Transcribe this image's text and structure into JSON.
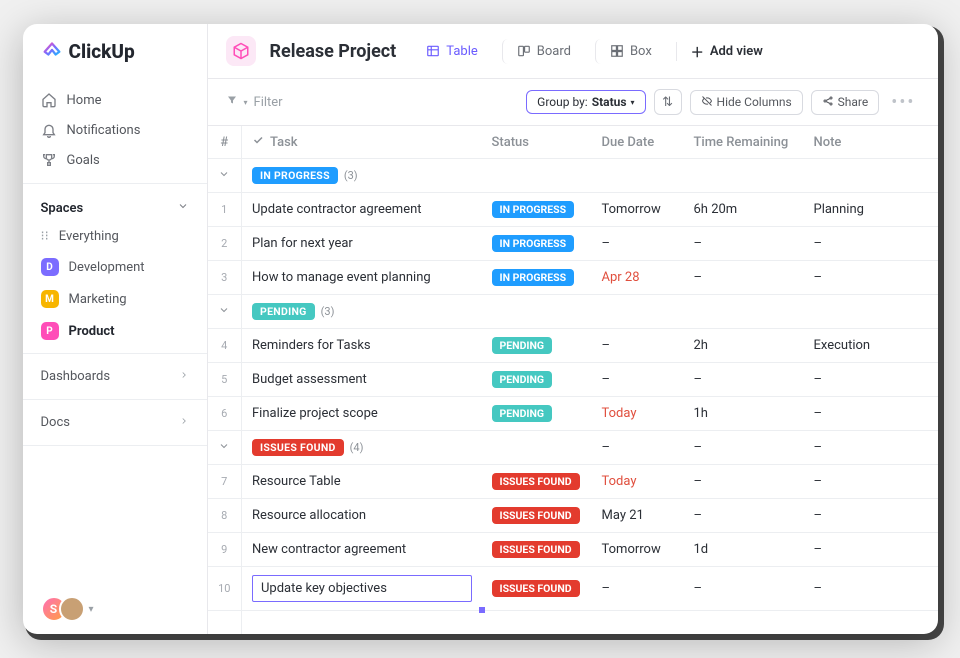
{
  "brand": "ClickUp",
  "sidebar": {
    "nav": [
      {
        "label": "Home"
      },
      {
        "label": "Notifications"
      },
      {
        "label": "Goals"
      }
    ],
    "spaces_label": "Spaces",
    "everything": "Everything",
    "spaces": [
      {
        "initial": "D",
        "label": "Development",
        "color": "#7b6cff",
        "active": false
      },
      {
        "initial": "M",
        "label": "Marketing",
        "color": "#f7b500",
        "active": false
      },
      {
        "initial": "P",
        "label": "Product",
        "color": "#ff4db8",
        "active": true
      }
    ],
    "dashboards": "Dashboards",
    "docs": "Docs",
    "avatar_initial": "S"
  },
  "header": {
    "title": "Release Project",
    "views": [
      {
        "label": "Table"
      },
      {
        "label": "Board"
      },
      {
        "label": "Box"
      }
    ],
    "add_view": "Add view"
  },
  "toolbar": {
    "filter": "Filter",
    "group_by_prefix": "Group by: ",
    "group_by_value": "Status",
    "hide_columns": "Hide Columns",
    "share": "Share"
  },
  "columns": {
    "hash": "#",
    "task": "Task",
    "status": "Status",
    "due": "Due Date",
    "time": "Time Remaining",
    "note": "Note"
  },
  "status_colors": {
    "IN PROGRESS": "#1f9dff",
    "PENDING": "#45c8c1",
    "ISSUES FOUND": "#e33b2e"
  },
  "groups": [
    {
      "status": "IN PROGRESS",
      "count": "(3)",
      "rows": [
        {
          "n": "1",
          "task": "Update contractor agreement",
          "status": "IN PROGRESS",
          "due": "Tomorrow",
          "due_overdue": false,
          "time": "6h 20m",
          "note": "Planning"
        },
        {
          "n": "2",
          "task": "Plan for next year",
          "status": "IN PROGRESS",
          "due": "–",
          "due_overdue": false,
          "time": "–",
          "note": "–"
        },
        {
          "n": "3",
          "task": "How to manage event planning",
          "status": "IN PROGRESS",
          "due": "Apr 28",
          "due_overdue": true,
          "time": "–",
          "note": "–"
        }
      ]
    },
    {
      "status": "PENDING",
      "count": "(3)",
      "rows": [
        {
          "n": "4",
          "task": "Reminders for Tasks",
          "status": "PENDING",
          "due": "–",
          "due_overdue": false,
          "time": "2h",
          "note": "Execution"
        },
        {
          "n": "5",
          "task": "Budget assessment",
          "status": "PENDING",
          "due": "–",
          "due_overdue": false,
          "time": "–",
          "note": "–"
        },
        {
          "n": "6",
          "task": "Finalize project scope",
          "status": "PENDING",
          "due": "Today",
          "due_overdue": true,
          "time": "1h",
          "note": "–"
        }
      ]
    },
    {
      "status": "ISSUES FOUND",
      "count": "(4)",
      "group_due": "–",
      "group_time": "–",
      "group_note": "–",
      "rows": [
        {
          "n": "7",
          "task": "Resource Table",
          "status": "ISSUES FOUND",
          "due": "Today",
          "due_overdue": true,
          "time": "–",
          "note": "–"
        },
        {
          "n": "8",
          "task": "Resource allocation",
          "status": "ISSUES FOUND",
          "due": "May 21",
          "due_overdue": false,
          "time": "–",
          "note": "–"
        },
        {
          "n": "9",
          "task": "New contractor agreement",
          "status": "ISSUES FOUND",
          "due": "Tomorrow",
          "due_overdue": false,
          "time": "1d",
          "note": "–"
        },
        {
          "n": "10",
          "task": "Update key objectives",
          "status": "ISSUES FOUND",
          "due": "–",
          "due_overdue": false,
          "time": "–",
          "note": "–",
          "editing": true
        }
      ]
    }
  ]
}
